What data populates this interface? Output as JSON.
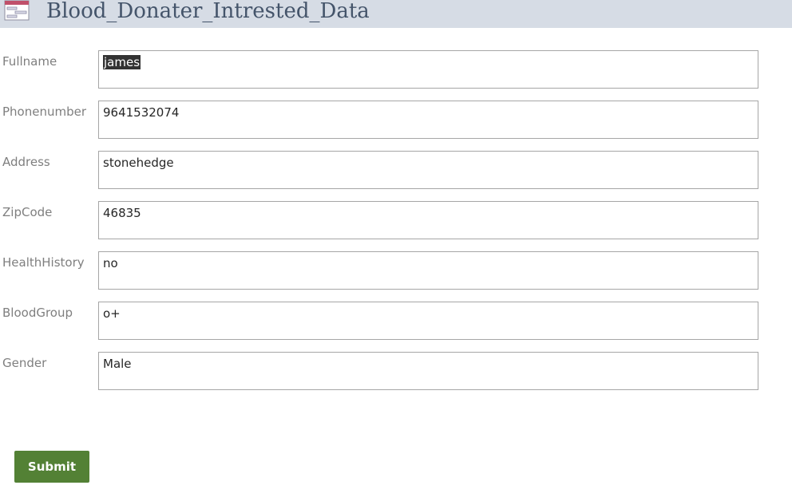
{
  "form": {
    "title": "Blood_Donater_Intrested_Data"
  },
  "fields": [
    {
      "label": "Fullname",
      "value": "james"
    },
    {
      "label": "Phonenumber",
      "value": "9641532074"
    },
    {
      "label": "Address",
      "value": "stonehedge"
    },
    {
      "label": "ZipCode",
      "value": "46835"
    },
    {
      "label": "HealthHistory",
      "value": "no"
    },
    {
      "label": "BloodGroup",
      "value": "o+"
    },
    {
      "label": "Gender",
      "value": "Male"
    }
  ],
  "actions": {
    "submit_label": "Submit"
  },
  "colors": {
    "title_bar": "#d6dce5",
    "title_text": "#44546a",
    "submit_button": "#538135",
    "selection_highlight": "#333333"
  },
  "icons": {
    "form": "form-icon"
  },
  "state": {
    "selected_field": "Fullname"
  }
}
